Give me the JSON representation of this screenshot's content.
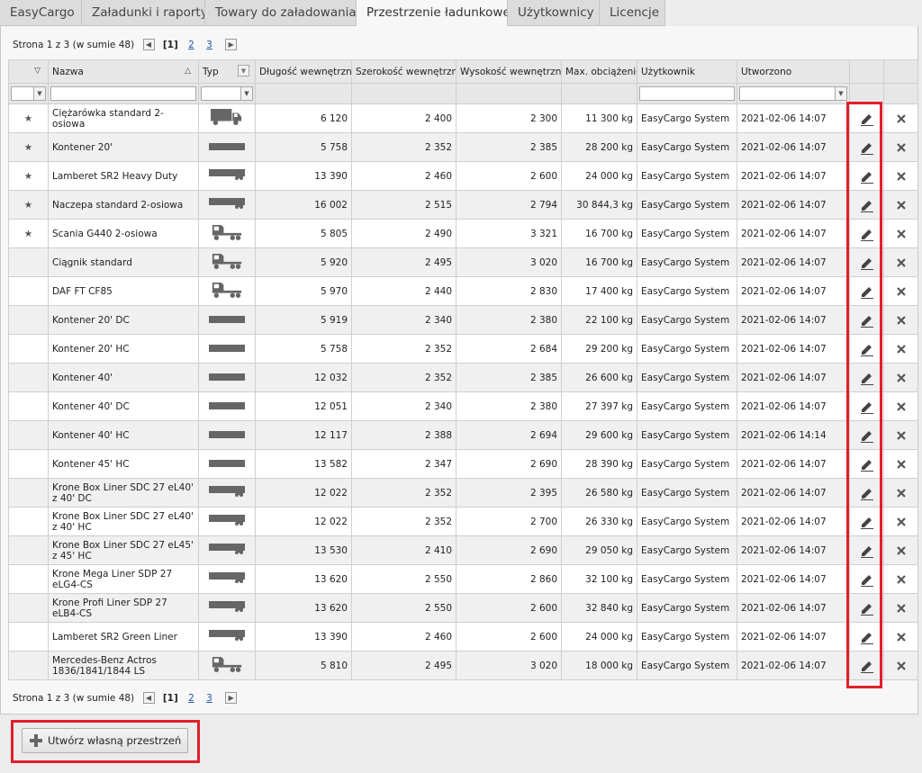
{
  "tabs": [
    {
      "label": "EasyCargo",
      "active": false
    },
    {
      "label": "Załadunki i raporty",
      "active": false
    },
    {
      "label": "Towary do załadowania",
      "active": false
    },
    {
      "label": "Przestrzenie ładunkowe",
      "active": true
    },
    {
      "label": "Użytkownicy",
      "active": false
    },
    {
      "label": "Licencje",
      "active": false
    }
  ],
  "pager": {
    "summary": "Strona 1 z 3 (w sumie 48)",
    "prev_icon": "chevron-left-icon",
    "next_icon": "chevron-right-icon",
    "current": "[1]",
    "page2": "2",
    "page3": "3"
  },
  "columns": {
    "fav": "",
    "name": "Nazwa",
    "type": "Typ",
    "length": "Długość wewnętrzna",
    "width": "Szerokość wewnętrzna",
    "height": "Wysokość wewnętrzna",
    "maxload": "Max. obciążenie",
    "user": "Użytkownik",
    "created": "Utworzono"
  },
  "rows": [
    {
      "fav": true,
      "name": "Ciężarówka standard 2-osiowa",
      "type": "truck",
      "length": "6 120",
      "width": "2 400",
      "height": "2 300",
      "maxload": "11 300 kg",
      "user": "EasyCargo System",
      "created": "2021-02-06 14:07"
    },
    {
      "fav": true,
      "name": "Kontener 20'",
      "type": "container",
      "length": "5 758",
      "width": "2 352",
      "height": "2 385",
      "maxload": "28 200 kg",
      "user": "EasyCargo System",
      "created": "2021-02-06 14:07"
    },
    {
      "fav": true,
      "name": "Lamberet SR2 Heavy Duty",
      "type": "trailer",
      "length": "13 390",
      "width": "2 460",
      "height": "2 600",
      "maxload": "24 000 kg",
      "user": "EasyCargo System",
      "created": "2021-02-06 14:07"
    },
    {
      "fav": true,
      "name": "Naczepa standard 2-osiowa",
      "type": "trailer",
      "length": "16 002",
      "width": "2 515",
      "height": "2 794",
      "maxload": "30 844,3 kg",
      "user": "EasyCargo System",
      "created": "2021-02-06 14:07"
    },
    {
      "fav": true,
      "name": "Scania G440 2-osiowa",
      "type": "tractor",
      "length": "5 805",
      "width": "2 490",
      "height": "3 321",
      "maxload": "16 700 kg",
      "user": "EasyCargo System",
      "created": "2021-02-06 14:07"
    },
    {
      "fav": false,
      "name": "Ciągnik standard",
      "type": "tractor",
      "length": "5 920",
      "width": "2 495",
      "height": "3 020",
      "maxload": "16 700 kg",
      "user": "EasyCargo System",
      "created": "2021-02-06 14:07"
    },
    {
      "fav": false,
      "name": "DAF FT CF85",
      "type": "tractor",
      "length": "5 970",
      "width": "2 440",
      "height": "2 830",
      "maxload": "17 400 kg",
      "user": "EasyCargo System",
      "created": "2021-02-06 14:07"
    },
    {
      "fav": false,
      "name": "Kontener 20' DC",
      "type": "container",
      "length": "5 919",
      "width": "2 340",
      "height": "2 380",
      "maxload": "22 100 kg",
      "user": "EasyCargo System",
      "created": "2021-02-06 14:07"
    },
    {
      "fav": false,
      "name": "Kontener 20' HC",
      "type": "container",
      "length": "5 758",
      "width": "2 352",
      "height": "2 684",
      "maxload": "29 200 kg",
      "user": "EasyCargo System",
      "created": "2021-02-06 14:07"
    },
    {
      "fav": false,
      "name": "Kontener 40'",
      "type": "container",
      "length": "12 032",
      "width": "2 352",
      "height": "2 385",
      "maxload": "26 600 kg",
      "user": "EasyCargo System",
      "created": "2021-02-06 14:07"
    },
    {
      "fav": false,
      "name": "Kontener 40' DC",
      "type": "container",
      "length": "12 051",
      "width": "2 340",
      "height": "2 380",
      "maxload": "27 397 kg",
      "user": "EasyCargo System",
      "created": "2021-02-06 14:07"
    },
    {
      "fav": false,
      "name": "Kontener 40' HC",
      "type": "container",
      "length": "12 117",
      "width": "2 388",
      "height": "2 694",
      "maxload": "29 600 kg",
      "user": "EasyCargo System",
      "created": "2021-02-06 14:14"
    },
    {
      "fav": false,
      "name": "Kontener 45' HC",
      "type": "container",
      "length": "13 582",
      "width": "2 347",
      "height": "2 690",
      "maxload": "28 390 kg",
      "user": "EasyCargo System",
      "created": "2021-02-06 14:07"
    },
    {
      "fav": false,
      "name": "Krone Box Liner SDC 27 eL40' z 40' DC",
      "type": "trailer",
      "length": "12 022",
      "width": "2 352",
      "height": "2 395",
      "maxload": "26 580 kg",
      "user": "EasyCargo System",
      "created": "2021-02-06 14:07"
    },
    {
      "fav": false,
      "name": "Krone Box Liner SDC 27 eL40' z 40' HC",
      "type": "trailer",
      "length": "12 022",
      "width": "2 352",
      "height": "2 700",
      "maxload": "26 330 kg",
      "user": "EasyCargo System",
      "created": "2021-02-06 14:07"
    },
    {
      "fav": false,
      "name": "Krone Box Liner SDC 27 eL45' z 45' HC",
      "type": "trailer",
      "length": "13 530",
      "width": "2 410",
      "height": "2 690",
      "maxload": "29 050 kg",
      "user": "EasyCargo System",
      "created": "2021-02-06 14:07"
    },
    {
      "fav": false,
      "name": "Krone Mega Liner SDP 27 eLG4-CS",
      "type": "trailer",
      "length": "13 620",
      "width": "2 550",
      "height": "2 860",
      "maxload": "32 100 kg",
      "user": "EasyCargo System",
      "created": "2021-02-06 14:07"
    },
    {
      "fav": false,
      "name": "Krone Profi Liner SDP 27 eLB4-CS",
      "type": "trailer",
      "length": "13 620",
      "width": "2 550",
      "height": "2 600",
      "maxload": "32 840 kg",
      "user": "EasyCargo System",
      "created": "2021-02-06 14:07"
    },
    {
      "fav": false,
      "name": "Lamberet SR2 Green Liner",
      "type": "trailer",
      "length": "13 390",
      "width": "2 460",
      "height": "2 600",
      "maxload": "24 000 kg",
      "user": "EasyCargo System",
      "created": "2021-02-06 14:07"
    },
    {
      "fav": false,
      "name": "Mercedes-Benz Actros 1836/1841/1844 LS",
      "type": "tractor",
      "length": "5 810",
      "width": "2 495",
      "height": "3 020",
      "maxload": "18 000 kg",
      "user": "EasyCargo System",
      "created": "2021-02-06 14:07"
    }
  ],
  "icons": {
    "favorite": "star-icon",
    "edit": "pencil-icon",
    "delete": "close-icon",
    "add": "plus-icon",
    "sort": "sort-icon",
    "dropdown": "chevron-down-icon"
  },
  "create_button": {
    "label": "Utwórz własną przestrzeń"
  },
  "colors": {
    "highlight": "#e0202a",
    "panel": "#f7f7f7",
    "header": "#e7e7e7",
    "tab": "#dcdcdc",
    "link": "#2255aa"
  }
}
